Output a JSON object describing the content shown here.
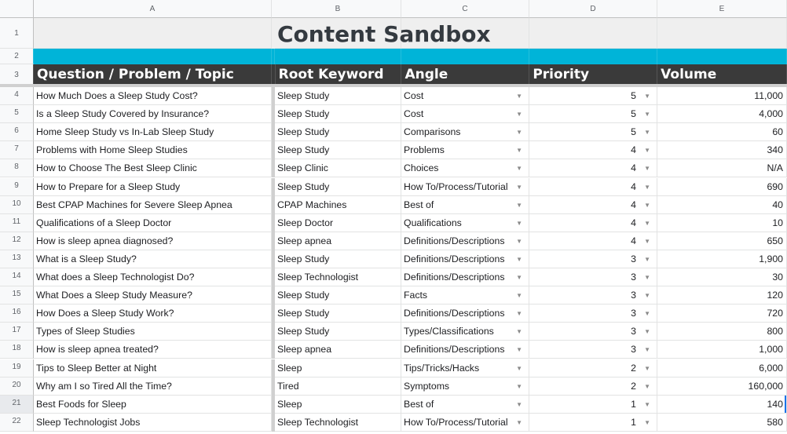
{
  "columns": [
    "A",
    "B",
    "C",
    "D",
    "E"
  ],
  "title": "Content Sandbox",
  "header_row_numbers": [
    "1",
    "2",
    "3"
  ],
  "headers": {
    "question": "Question / Problem / Topic",
    "root_keyword": "Root Keyword",
    "angle": "Angle",
    "priority": "Priority",
    "volume": "Volume"
  },
  "colors": {
    "accent_band": "#00b4d8",
    "header_bg": "#3a3a3a",
    "title_bg": "#efefef",
    "selection": "#1a73e8"
  },
  "selected_row": "21",
  "rows": [
    {
      "num": "4",
      "question": "How Much Does a Sleep Study Cost?",
      "root_keyword": "Sleep Study",
      "angle": "Cost",
      "priority": "5",
      "volume": "11,000"
    },
    {
      "num": "5",
      "question": "Is a Sleep Study Covered by Insurance?",
      "root_keyword": "Sleep Study",
      "angle": "Cost",
      "priority": "5",
      "volume": "4,000"
    },
    {
      "num": "6",
      "question": "Home Sleep Study vs In-Lab Sleep Study",
      "root_keyword": "Sleep Study",
      "angle": "Comparisons",
      "priority": "5",
      "volume": "60"
    },
    {
      "num": "7",
      "question": "Problems with Home Sleep Studies",
      "root_keyword": "Sleep Study",
      "angle": "Problems",
      "priority": "4",
      "volume": "340"
    },
    {
      "num": "8",
      "question": "How to Choose The Best Sleep Clinic",
      "root_keyword": "Sleep Clinic",
      "angle": "Choices",
      "priority": "4",
      "volume": "N/A"
    },
    {
      "num": "9",
      "question": "How to Prepare for a Sleep Study",
      "root_keyword": "Sleep Study",
      "angle": "How To/Process/Tutorial",
      "priority": "4",
      "volume": "690"
    },
    {
      "num": "10",
      "question": "Best CPAP Machines for Severe Sleep Apnea",
      "root_keyword": "CPAP Machines",
      "angle": "Best of",
      "priority": "4",
      "volume": "40"
    },
    {
      "num": "11",
      "question": "Qualifications of a Sleep Doctor",
      "root_keyword": "Sleep Doctor",
      "angle": "Qualifications",
      "priority": "4",
      "volume": "10"
    },
    {
      "num": "12",
      "question": "How is sleep apnea diagnosed?",
      "root_keyword": "Sleep apnea",
      "angle": "Definitions/Descriptions",
      "priority": "4",
      "volume": "650"
    },
    {
      "num": "13",
      "question": "What is a Sleep Study?",
      "root_keyword": "Sleep Study",
      "angle": "Definitions/Descriptions",
      "priority": "3",
      "volume": "1,900"
    },
    {
      "num": "14",
      "question": "What does a Sleep Technologist Do?",
      "root_keyword": "Sleep Technologist",
      "angle": "Definitions/Descriptions",
      "priority": "3",
      "volume": "30"
    },
    {
      "num": "15",
      "question": "What Does a Sleep Study Measure?",
      "root_keyword": "Sleep Study",
      "angle": "Facts",
      "priority": "3",
      "volume": "120"
    },
    {
      "num": "16",
      "question": "How Does a Sleep Study Work?",
      "root_keyword": "Sleep Study",
      "angle": "Definitions/Descriptions",
      "priority": "3",
      "volume": "720"
    },
    {
      "num": "17",
      "question": "Types of Sleep Studies",
      "root_keyword": "Sleep Study",
      "angle": "Types/Classifications",
      "priority": "3",
      "volume": "800"
    },
    {
      "num": "18",
      "question": "How is sleep apnea treated?",
      "root_keyword": "Sleep apnea",
      "angle": "Definitions/Descriptions",
      "priority": "3",
      "volume": "1,000"
    },
    {
      "num": "19",
      "question": "Tips to Sleep Better at Night",
      "root_keyword": "Sleep",
      "angle": "Tips/Tricks/Hacks",
      "priority": "2",
      "volume": "6,000"
    },
    {
      "num": "20",
      "question": "Why am I so Tired All the Time?",
      "root_keyword": "Tired",
      "angle": "Symptoms",
      "priority": "2",
      "volume": "160,000"
    },
    {
      "num": "21",
      "question": "Best Foods for Sleep",
      "root_keyword": "Sleep",
      "angle": "Best of",
      "priority": "1",
      "volume": "140"
    },
    {
      "num": "22",
      "question": "Sleep Technologist Jobs",
      "root_keyword": "Sleep Technologist",
      "angle": "How To/Process/Tutorial",
      "priority": "1",
      "volume": "580"
    }
  ]
}
